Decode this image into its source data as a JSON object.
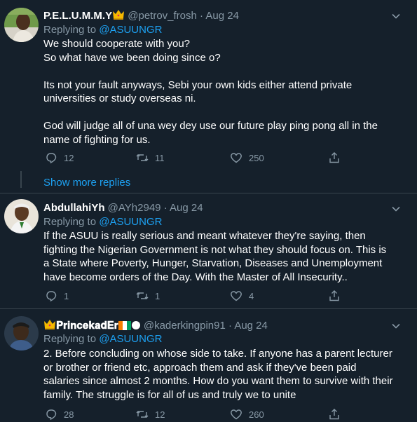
{
  "tweets": [
    {
      "display_name": "P.E.L.U.M.M.Y",
      "handle": "@petrov_frosh",
      "sep": "·",
      "date": "Aug 24",
      "replying_prefix": "Replying to",
      "replying_to": "@ASUUNGR",
      "body": "We should cooperate with you?\nSo what have we been doing since o?\n\nIts not your fault anyways, Sebi your own kids either attend private universities or study overseas ni.\n\nGod will judge all of una wey dey use our future play ping pong all in the name of fighting for us.",
      "replies": "12",
      "retweets": "11",
      "likes": "250"
    },
    {
      "display_name": "AbdullahiYh",
      "handle": "@AYh2949",
      "sep": "·",
      "date": "Aug 24",
      "replying_prefix": "Replying to",
      "replying_to": "@ASUUNGR",
      "body": "If the ASUU is really serious and meant whatever they're saying, then fighting the Nigerian Government is not what they should focus on. This is a State where Poverty, Hunger, Starvation, Diseases and Unemployment have become orders of the Day. With the Master of All Insecurity..",
      "replies": "1",
      "retweets": "1",
      "likes": "4"
    },
    {
      "display_name": "𝐏𝐫𝐢𝐧𝐜𝐞𝐤𝐚𝐝𝐄𝐫",
      "handle": "@kaderkingpin91",
      "sep": "·",
      "date": "Aug 24",
      "replying_prefix": "Replying to",
      "replying_to": "@ASUUNGR",
      "body": "2. Before concluding on whose side to take. If anyone has a parent lecturer or brother or friend etc, approach them and ask if they've been paid salaries since almost 2 months. How do you want them to survive with their family. The struggle is for all of us and truly we to unite",
      "replies": "28",
      "retweets": "12",
      "likes": "260"
    }
  ],
  "show_more_replies": "Show more replies",
  "colors": {
    "background": "#15202b",
    "divider": "#38444d",
    "text": "#ffffff",
    "muted": "#8899a6",
    "link": "#1da1f2"
  },
  "icons": [
    "reply-icon",
    "retweet-icon",
    "like-icon",
    "share-icon",
    "caret-down-icon",
    "crown-icon",
    "ivory-coast-flag-icon",
    "circle-icon"
  ]
}
